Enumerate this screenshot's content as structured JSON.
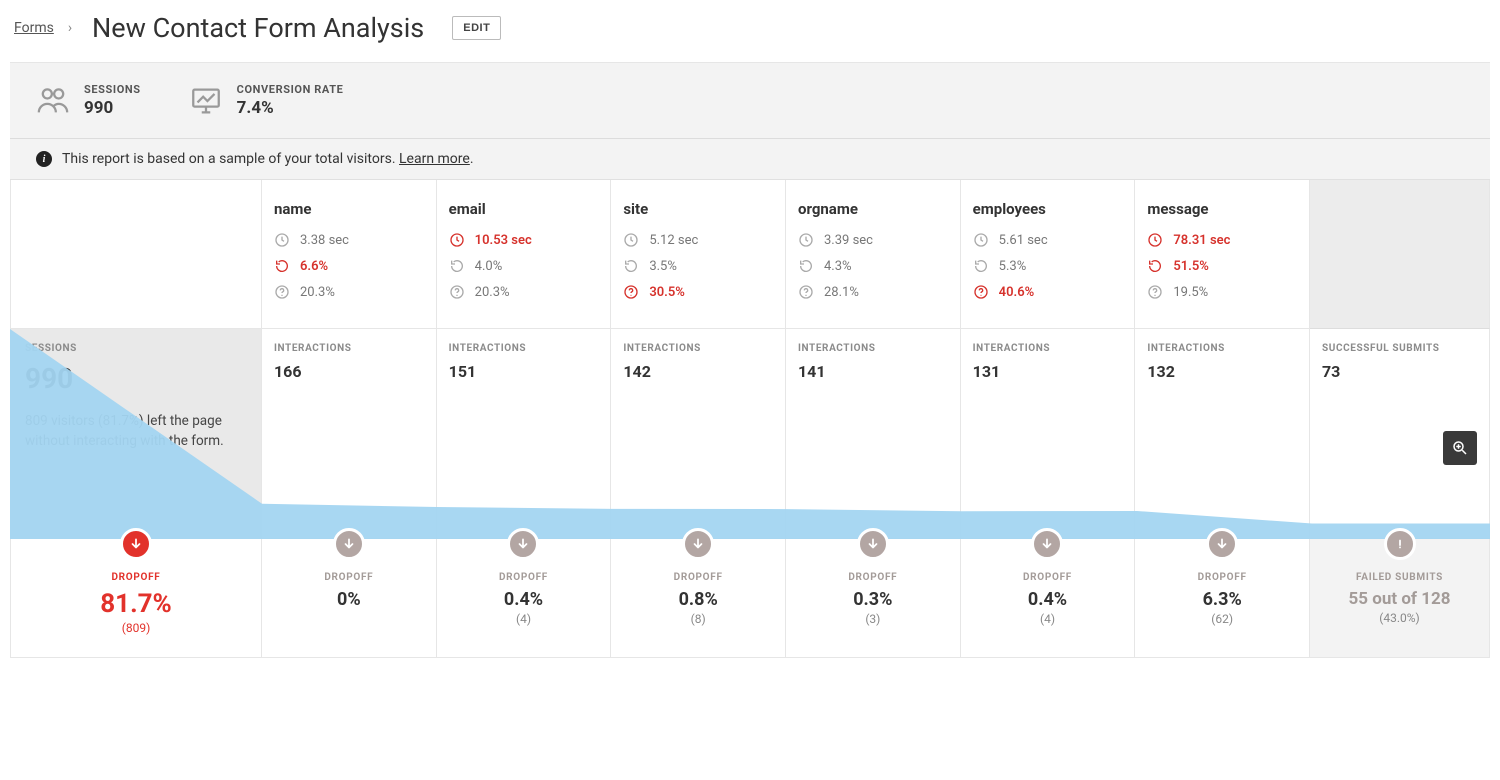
{
  "breadcrumb": {
    "root": "Forms"
  },
  "page_title": "New Contact Form Analysis",
  "edit_label": "EDIT",
  "stats": {
    "sessions_label": "SESSIONS",
    "sessions_value": "990",
    "conversion_label": "CONVERSION RATE",
    "conversion_value": "7.4%"
  },
  "notice": {
    "text": "This report is based on a sample of your total visitors.",
    "learn_more": "Learn more"
  },
  "fields": [
    {
      "name": "name",
      "time": "3.38 sec",
      "time_red": false,
      "redo": "6.6%",
      "redo_red": true,
      "help": "20.3%",
      "help_red": false
    },
    {
      "name": "email",
      "time": "10.53 sec",
      "time_red": true,
      "redo": "4.0%",
      "redo_red": false,
      "help": "20.3%",
      "help_red": false
    },
    {
      "name": "site",
      "time": "5.12 sec",
      "time_red": false,
      "redo": "3.5%",
      "redo_red": false,
      "help": "30.5%",
      "help_red": true
    },
    {
      "name": "orgname",
      "time": "3.39 sec",
      "time_red": false,
      "redo": "4.3%",
      "redo_red": false,
      "help": "28.1%",
      "help_red": false
    },
    {
      "name": "employees",
      "time": "5.61 sec",
      "time_red": false,
      "redo": "5.3%",
      "redo_red": false,
      "help": "40.6%",
      "help_red": true
    },
    {
      "name": "message",
      "time": "78.31 sec",
      "time_red": true,
      "redo": "51.5%",
      "redo_red": true,
      "help": "19.5%",
      "help_red": false
    }
  ],
  "sessions_cell": {
    "label": "SESSIONS",
    "value": "990",
    "desc": "809 visitors (81.7%) left the page without interacting with the form."
  },
  "interactions_label": "INTERACTIONS",
  "interactions": [
    "166",
    "151",
    "142",
    "141",
    "131",
    "132"
  ],
  "submits": {
    "label": "SUCCESSFUL SUBMITS",
    "value": "73"
  },
  "dropoff_label": "DROPOFF",
  "session_dropoff": {
    "pct": "81.7%",
    "count": "(809)"
  },
  "dropoffs": [
    {
      "pct": "0%",
      "count": ""
    },
    {
      "pct": "0.4%",
      "count": "(4)"
    },
    {
      "pct": "0.8%",
      "count": "(8)"
    },
    {
      "pct": "0.3%",
      "count": "(3)"
    },
    {
      "pct": "0.4%",
      "count": "(4)"
    },
    {
      "pct": "6.3%",
      "count": "(62)"
    }
  ],
  "failed": {
    "label": "FAILED SUBMITS",
    "main": "55 out of 128",
    "sub": "(43.0%)"
  },
  "chart_data": {
    "type": "funnel",
    "title": "New Contact Form Analysis",
    "stages": [
      "sessions",
      "name",
      "email",
      "site",
      "orgname",
      "employees",
      "message",
      "submits"
    ],
    "values": [
      990,
      166,
      151,
      142,
      141,
      131,
      132,
      73
    ],
    "dropoff_pct": [
      81.7,
      0,
      0.4,
      0.8,
      0.3,
      0.4,
      6.3,
      null
    ],
    "conversion_rate_pct": 7.4,
    "failed_submits": {
      "failed": 55,
      "total": 128,
      "pct": 43.0
    }
  }
}
